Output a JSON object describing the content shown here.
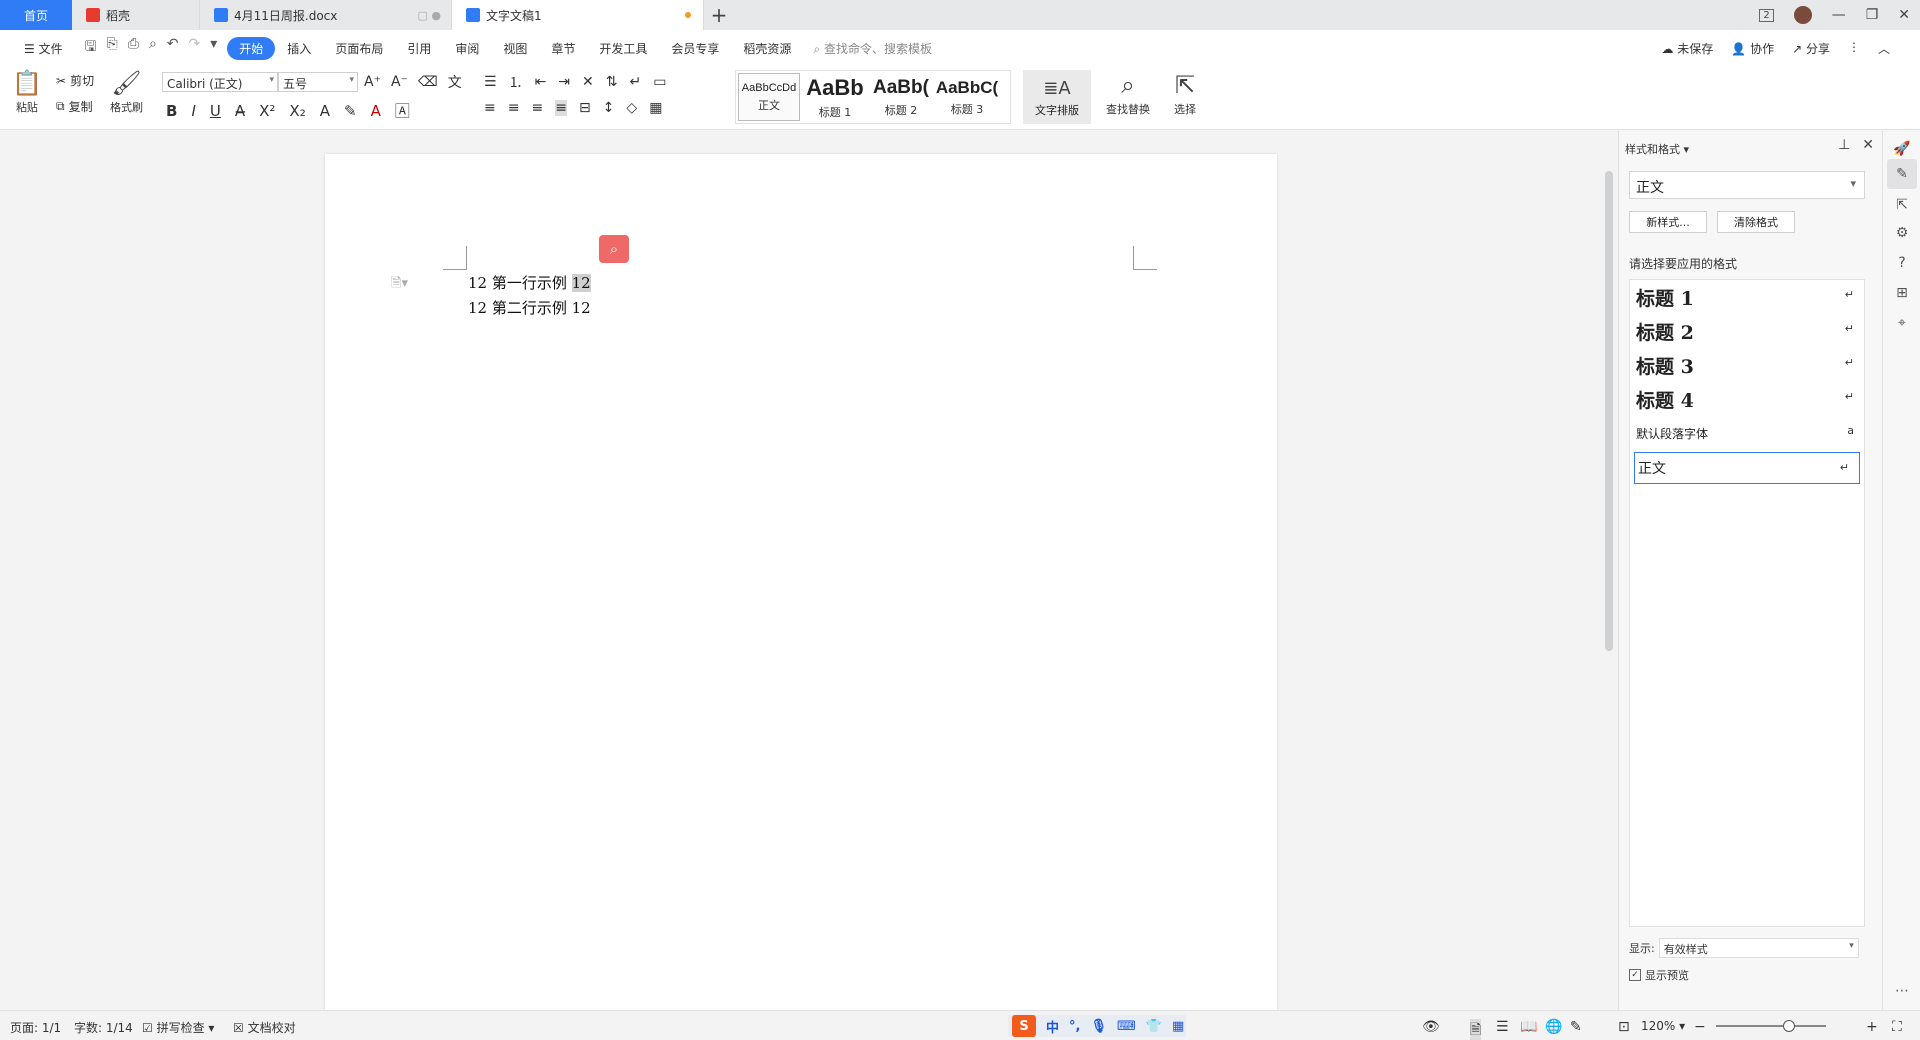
{
  "tabs": {
    "home": "首页",
    "items": [
      {
        "label": "稻壳",
        "color": "red"
      },
      {
        "label": "4月11日周报.docx",
        "color": "blue"
      },
      {
        "label": "文字文稿1",
        "color": "blue",
        "modified": true
      }
    ],
    "new_tab": "+",
    "badge_count": "2"
  },
  "menu": {
    "file": "文件",
    "items": [
      "开始",
      "插入",
      "页面布局",
      "引用",
      "审阅",
      "视图",
      "章节",
      "开发工具",
      "会员专享",
      "稻壳资源"
    ],
    "active": "开始",
    "search_placeholder": "查找命令、搜索模板",
    "right": {
      "unsaved": "未保存",
      "collab": "协作",
      "share": "分享"
    }
  },
  "ribbon": {
    "paste": "粘贴",
    "cut": "剪切",
    "copy": "复制",
    "format_painter": "格式刷",
    "font_name": "Calibri (正文)",
    "font_size": "五号",
    "styles": [
      {
        "sample": "AaBbCcDd",
        "label": "正文"
      },
      {
        "sample": "AaBb",
        "label": "标题 1"
      },
      {
        "sample": "AaBb(",
        "label": "标题 2"
      },
      {
        "sample": "AaBbC(",
        "label": "标题 3"
      }
    ],
    "text_layout": "文字排版",
    "find_replace": "查找替换",
    "select": "选择"
  },
  "document": {
    "lines": [
      {
        "prefix": "12 第一行示例 ",
        "highlight": "12"
      },
      {
        "prefix": "12 第二行示例 ",
        "highlight": "",
        "suffix": "12"
      }
    ]
  },
  "panel": {
    "title": "样式和格式",
    "current_style": "正文",
    "new_style": "新样式...",
    "clear_format": "清除格式",
    "apply_label": "请选择要应用的格式",
    "styles": [
      {
        "label": "标题 1",
        "kind": "heading",
        "mark": "↵"
      },
      {
        "label": "标题 2",
        "kind": "heading",
        "mark": "↵"
      },
      {
        "label": "标题 3",
        "kind": "heading",
        "mark": "↵"
      },
      {
        "label": "标题 4",
        "kind": "heading",
        "mark": "↵"
      },
      {
        "label": "默认段落字体",
        "kind": "small",
        "mark": "a"
      },
      {
        "label": "正文",
        "kind": "body",
        "mark": "↵"
      }
    ],
    "display_label": "显示:",
    "display_value": "有效样式",
    "preview_label": "显示预览"
  },
  "status": {
    "page": "页面: 1/1",
    "words": "字数: 1/14",
    "spell": "拼写检查",
    "proof": "文档校对",
    "zoom": "120%",
    "ime_mode": "中"
  },
  "colors": {
    "accent": "#2f7cf6",
    "tab_red": "#e63b2e",
    "float_search": "#f06969",
    "ime_logo": "#f25b1c"
  }
}
